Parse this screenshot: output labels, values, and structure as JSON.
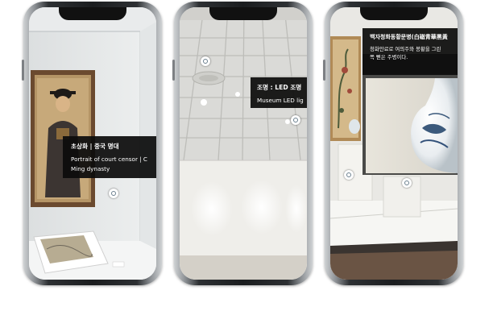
{
  "phones": [
    {
      "scene": "museum-portrait-gallery",
      "tooltip": {
        "title_ko": "초상화 | 중국 명대",
        "line1_en": "Portrait of court censor | C",
        "line2_en": "Ming dynasty"
      }
    },
    {
      "scene": "museum-ceiling-lights",
      "tooltip": {
        "title_ko": "조명 : LED 조명",
        "line1_en": "Museum LED lig"
      }
    },
    {
      "scene": "museum-porcelain-vitrine",
      "tooltip": {
        "title_ko": "백자청화동황문병(白磁青華黑黃",
        "line1_ko": "청화안료로 여의주와 봉황을 그린",
        "line2_ko": "쪽 뻗은 주병이다."
      }
    }
  ],
  "colors": {
    "tooltip_bg": "#0c0c0c",
    "hotspot_ring": "#6a7f8e",
    "phone_frame": "#1b1d1f"
  }
}
